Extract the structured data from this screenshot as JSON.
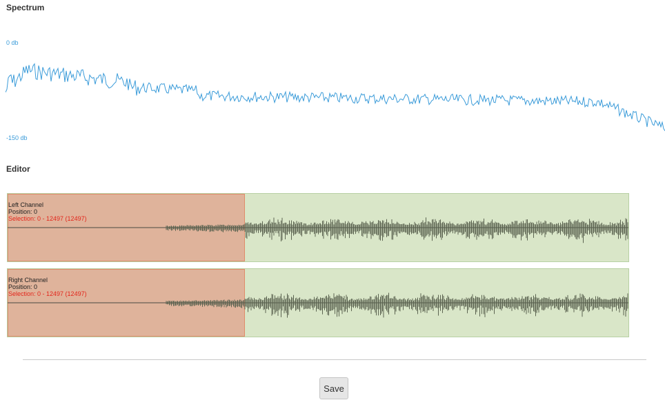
{
  "spectrum": {
    "title": "Spectrum",
    "db_max_label": "0 db",
    "db_min_label": "-150 db",
    "line_color": "#3a9bd9"
  },
  "editor": {
    "title": "Editor",
    "channels": [
      {
        "name": "Left Channel",
        "position_text": "Position: 0",
        "selection_text": "Selection: 0 - 12497 (12497)"
      },
      {
        "name": "Right Channel",
        "position_text": "Position: 0",
        "selection_text": "Selection: 0 - 12497 (12497)"
      }
    ],
    "colors": {
      "track_background": "#d9e6c8",
      "selection_background": "#dfb39b",
      "selection_text": "#e3261b",
      "waveform": "#5b6350"
    }
  },
  "actions": {
    "save_label": "Save"
  }
}
